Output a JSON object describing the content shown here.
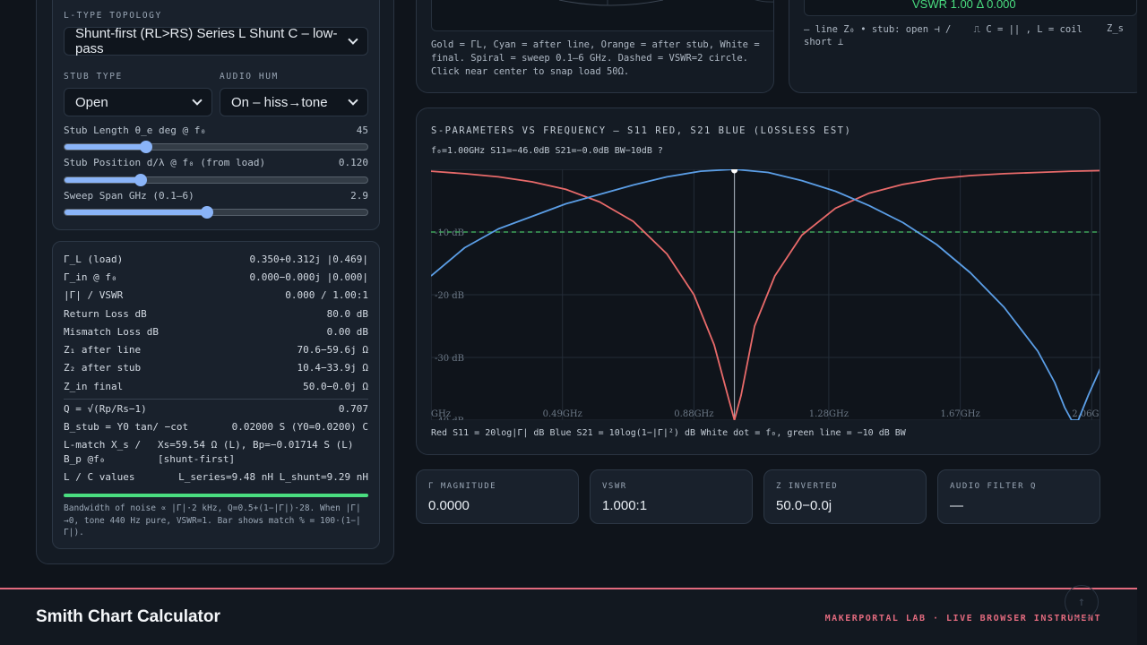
{
  "topology": {
    "label": "L-TYPE TOPOLOGY",
    "selected": "Shunt-first (RL>RS) Series L Shunt C – low-pass"
  },
  "stub_type": {
    "label": "STUB TYPE",
    "selected": "Open"
  },
  "audio_hum": {
    "label": "AUDIO HUM",
    "selected": "On – hiss→tone"
  },
  "sliders": [
    {
      "label": "Stub Length θ_e deg @ f₀",
      "value": "45",
      "fraction": 0.27
    },
    {
      "label": "Stub Position d/λ @ f₀ (from load)",
      "value": "0.120",
      "fraction": 0.25
    },
    {
      "label": "Sweep Span GHz (0.1–6)",
      "value": "2.9",
      "fraction": 0.47
    }
  ],
  "readouts": [
    {
      "k": "Γ_L (load)",
      "v": "0.350+0.312j |0.469|"
    },
    {
      "k": "Γ_in @ f₀",
      "v": "0.000−0.000j |0.000|"
    },
    {
      "k": "|Γ| / VSWR",
      "v": "0.000 / 1.00:1"
    },
    {
      "k": "Return Loss dB",
      "v": "80.0 dB"
    },
    {
      "k": "Mismatch Loss dB",
      "v": "0.00 dB"
    },
    {
      "k": "Z₁ after line",
      "v": "70.6−59.6j Ω"
    },
    {
      "k": "Z₂ after stub",
      "v": "10.4−33.9j Ω"
    },
    {
      "k": "Z_in final",
      "v": "50.0−0.0j Ω"
    }
  ],
  "calcs": [
    {
      "k": "Q = √(Rp/Rs−1)",
      "m": "",
      "v": "0.707"
    },
    {
      "k": "B_stub = Y0 tan/ −cot",
      "m": "",
      "v": "0.02000 S (Y0=0.0200) C"
    },
    {
      "k": "L-match X_s /",
      "m": "Xs=59.54 Ω (L), Bp=−0.01714 S (L)",
      "v": ""
    },
    {
      "k": "B_p @f₀",
      "m": "[shunt-first]",
      "v": ""
    },
    {
      "k": "L / C values",
      "m": "",
      "v": "L_series=9.48 nH L_shunt=9.29 nH"
    }
  ],
  "note": "Bandwidth of noise ∝ |Γ|·2 kHz, Q=0.5+(1−|Γ|)·28. When |Γ|→0, tone 440 Hz pure, VSWR=1. Bar shows match % = 100·(1−|Γ|).",
  "smith_caption": "Gold = ΓL, Cyan = after line, Orange = after stub, White = final. Spiral = sweep 0.1–6 GHz. Dashed = VSWR=2 circle. Click near center to snap load 50Ω.",
  "panel": {
    "vswr": "VSWR 1.00 Δ 0.000",
    "legend_line1": "— line Z₀ • stub: open ⊣ /    ⎍ C = || , L = coil",
    "legend_right": "Z_s",
    "legend_line2": "short ⊥"
  },
  "sparams": {
    "title": "S-PARAMETERS VS FREQUENCY — S11 RED, S21 BLUE (LOSSLESS EST)",
    "readout": "f₀=1.00GHz S11=−46.0dB S21=−0.0dB BW−10dB ?",
    "caption": "Red S11 = 20log|Γ| dB  Blue S21 = 10log(1−|Γ|²) dB  White dot = f₀, green line = −10 dB BW"
  },
  "metrics": [
    {
      "label": "Γ MAGNITUDE",
      "value": "0.0000"
    },
    {
      "label": "VSWR",
      "value": "1.000:1"
    },
    {
      "label": "Z INVERTED",
      "value": "50.0−0.0j"
    },
    {
      "label": "AUDIO FILTER Q",
      "value": "—"
    }
  ],
  "footer": {
    "brand": "Smith Chart Calculator",
    "tag": "MAKERPORTAL LAB · LIVE BROWSER INSTRUMENT",
    "scroll_icon": "arrow-up-icon"
  },
  "chart_data": {
    "type": "line",
    "title": "S-PARAMETERS VS FREQUENCY — S11 RED, S21 BLUE (LOSSLESS EST)",
    "xlabel": "",
    "ylabel": "",
    "x_tick_labels": [
      "GHz",
      "0.49GHz",
      "0.88GHz",
      "1.28GHz",
      "1.67GHz",
      "2.06GHz"
    ],
    "x_ticks": [
      0.1,
      0.49,
      0.88,
      1.28,
      1.67,
      2.06
    ],
    "y_tick_labels": [
      "-10 dB",
      "-20 dB",
      "-30 dB",
      "-40 dB"
    ],
    "y_ticks": [
      -10,
      -20,
      -30,
      -40
    ],
    "xlim": [
      0.1,
      2.2
    ],
    "ylim": [
      -40,
      0
    ],
    "f0": 1.0,
    "bw_line": -10,
    "colors": {
      "s11": "#e86a6a",
      "s21": "#5b9ee6",
      "bw": "#3fa45a",
      "marker": "#ffffff"
    },
    "series": [
      {
        "name": "S11",
        "x": [
          0.1,
          0.2,
          0.3,
          0.4,
          0.5,
          0.6,
          0.7,
          0.8,
          0.88,
          0.94,
          0.98,
          1.0,
          1.02,
          1.06,
          1.12,
          1.2,
          1.3,
          1.4,
          1.5,
          1.6,
          1.7,
          1.8,
          1.9,
          2.0,
          2.1,
          2.2
        ],
        "y": [
          -0.3,
          -0.7,
          -1.2,
          -2.0,
          -3.2,
          -5.2,
          -8.3,
          -13.5,
          -20.0,
          -28.0,
          -36.0,
          -40.0,
          -36.0,
          -25.0,
          -17.0,
          -10.5,
          -6.2,
          -3.8,
          -2.4,
          -1.5,
          -1.0,
          -0.7,
          -0.5,
          -0.3,
          -0.2,
          -0.1
        ]
      },
      {
        "name": "S21",
        "x": [
          0.1,
          0.2,
          0.3,
          0.4,
          0.5,
          0.6,
          0.7,
          0.8,
          0.9,
          1.0,
          1.1,
          1.2,
          1.3,
          1.4,
          1.5,
          1.6,
          1.7,
          1.8,
          1.9,
          1.95,
          1.98,
          2.0,
          2.02,
          2.05,
          2.1,
          2.15,
          2.2
        ],
        "y": [
          -17.0,
          -12.5,
          -9.5,
          -7.5,
          -5.5,
          -4.0,
          -2.5,
          -1.2,
          -0.3,
          -0.0,
          -0.5,
          -1.8,
          -3.5,
          -5.8,
          -8.5,
          -12.0,
          -16.5,
          -22.0,
          -29.0,
          -34.0,
          -38.0,
          -40.0,
          -40.0,
          -36.0,
          -30.0,
          -25.0,
          -20.0
        ]
      }
    ]
  }
}
